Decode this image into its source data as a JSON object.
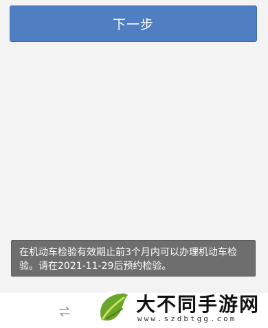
{
  "actions": {
    "next_label": "下一步"
  },
  "toast": {
    "message": "在机动车检验有效期止前3个月内可以办理机动车检验。请在2021-11-29后预约检验。"
  },
  "bottom_bar": {
    "swap_icon": "swap-arrows-icon"
  },
  "watermark": {
    "title": "大不同手游网",
    "url": "www.szdbtgg.com",
    "logo": "leaf-logo"
  }
}
